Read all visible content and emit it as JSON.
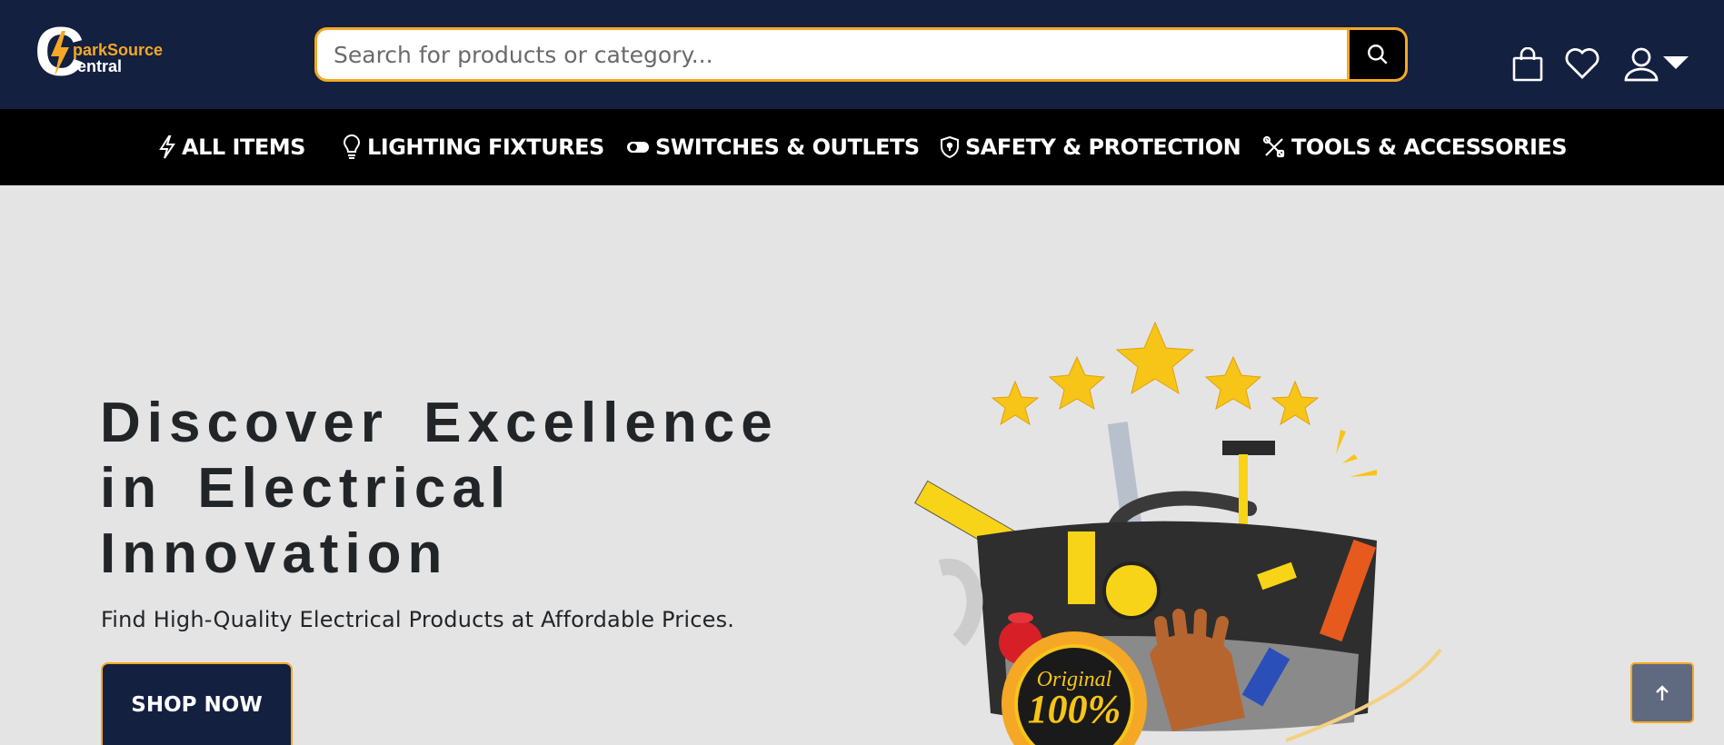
{
  "brand": {
    "logo_line1": "parkSource",
    "logo_line2": "entral",
    "logo_letter": "C",
    "accent": "#f4a825",
    "navy": "#132040"
  },
  "search": {
    "placeholder": "Search for products or category...",
    "value": ""
  },
  "header_icons": [
    "shopping-bag-icon",
    "heart-icon",
    "user-icon",
    "caret-down-icon"
  ],
  "nav": {
    "items": [
      {
        "label": "ALL ITEMS",
        "icon": "lightning-icon"
      },
      {
        "label": "LIGHTING FIXTURES",
        "icon": "lightbulb-icon"
      },
      {
        "label": "SWITCHES & OUTLETS",
        "icon": "toggle-icon"
      },
      {
        "label": "SAFETY & PROTECTION",
        "icon": "shield-icon"
      },
      {
        "label": "TOOLS & ACCESSORIES",
        "icon": "tools-icon"
      }
    ]
  },
  "hero": {
    "title_line1": "Discover Excellence",
    "title_line2": "in Electrical",
    "title_line3": "Innovation",
    "subtitle": "Find High-Quality Electrical Products at Affordable Prices.",
    "cta": "SHOP NOW",
    "badge_line1": "Original",
    "badge_line2": "100%"
  },
  "scroll_top_icon": "arrow-up-icon"
}
